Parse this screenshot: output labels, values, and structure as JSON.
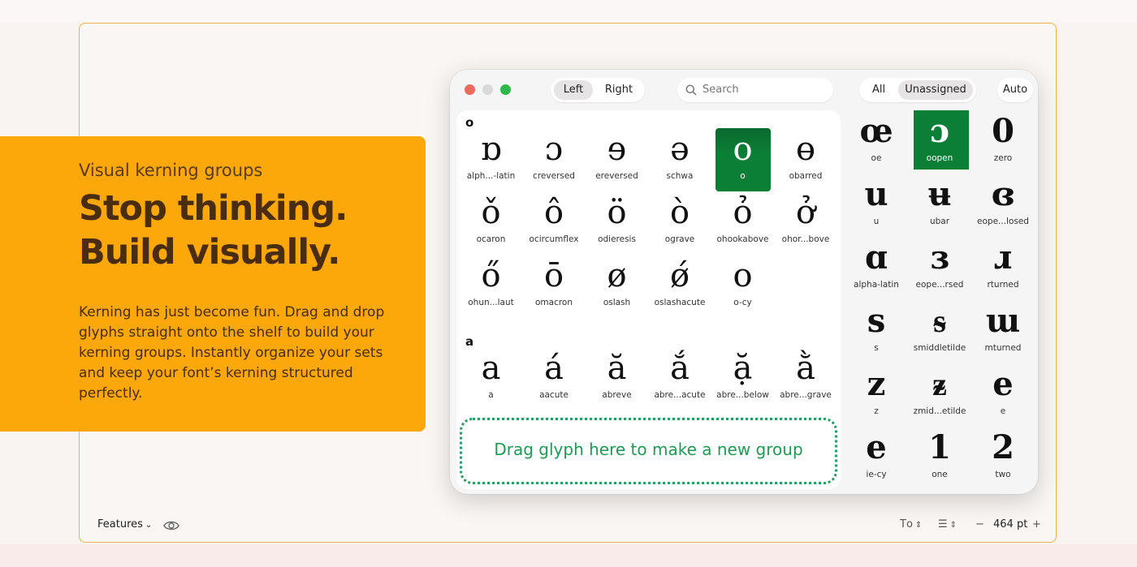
{
  "promo": {
    "kicker": "Visual kerning groups",
    "title_line1": "Stop thinking.",
    "title_line2": "Build visually.",
    "body": "Kerning has just become fun. Drag and drop glyphs straight onto the shelf to build your kerning groups. Instantly organize your sets and keep your font’s kerning structured perfectly."
  },
  "toolbar": {
    "side_left": "Left",
    "side_right": "Right",
    "search_placeholder": "Search",
    "filter_all": "All",
    "filter_unassigned": "Unassigned",
    "auto": "Auto"
  },
  "groups": [
    {
      "name": "o",
      "glyphs": [
        {
          "char": "ɒ",
          "label": "alph...-latin",
          "selected": false
        },
        {
          "char": "ɔ",
          "label": "creversed",
          "selected": false
        },
        {
          "char": "ɘ",
          "label": "ereversed",
          "selected": false
        },
        {
          "char": "ə",
          "label": "schwa",
          "selected": false
        },
        {
          "char": "o",
          "label": "o",
          "selected": true
        },
        {
          "char": "ɵ",
          "label": "obarred",
          "selected": false
        },
        {
          "char": "ǒ",
          "label": "ocaron",
          "selected": false
        },
        {
          "char": "ô",
          "label": "ocircumflex",
          "selected": false
        },
        {
          "char": "ö",
          "label": "odieresis",
          "selected": false
        },
        {
          "char": "ò",
          "label": "ograve",
          "selected": false
        },
        {
          "char": "ỏ",
          "label": "ohookabove",
          "selected": false
        },
        {
          "char": "ở",
          "label": "ohor...bove",
          "selected": false
        },
        {
          "char": "ő",
          "label": "ohun...laut",
          "selected": false
        },
        {
          "char": "ō",
          "label": "omacron",
          "selected": false
        },
        {
          "char": "ø",
          "label": "oslash",
          "selected": false
        },
        {
          "char": "ǿ",
          "label": "oslashacute",
          "selected": false
        },
        {
          "char": "о",
          "label": "o-cy",
          "selected": false
        }
      ]
    },
    {
      "name": "a",
      "glyphs": [
        {
          "char": "a",
          "label": "a",
          "selected": false
        },
        {
          "char": "á",
          "label": "aacute",
          "selected": false
        },
        {
          "char": "ă",
          "label": "abreve",
          "selected": false
        },
        {
          "char": "ắ",
          "label": "abre...acute",
          "selected": false
        },
        {
          "char": "ặ",
          "label": "abre...below",
          "selected": false
        },
        {
          "char": "ằ",
          "label": "abre...grave",
          "selected": false
        }
      ]
    }
  ],
  "dropzone_text": "Drag glyph here to make a new group",
  "unassigned": [
    {
      "char": "œ",
      "label": "oe",
      "selected": false
    },
    {
      "char": "ɔ",
      "label": "oopen",
      "selected": true
    },
    {
      "char": "0",
      "label": "zero",
      "selected": false
    },
    {
      "char": "u",
      "label": "u",
      "selected": false
    },
    {
      "char": "ʉ",
      "label": "ubar",
      "selected": false
    },
    {
      "char": "ɞ",
      "label": "eope...losed",
      "selected": false
    },
    {
      "char": "ɑ",
      "label": "alpha-latin",
      "selected": false
    },
    {
      "char": "ɜ",
      "label": "eope...rsed",
      "selected": false
    },
    {
      "char": "ɹ",
      "label": "rturned",
      "selected": false
    },
    {
      "char": "s",
      "label": "s",
      "selected": false
    },
    {
      "char": "ᵴ",
      "label": "smiddletilde",
      "selected": false
    },
    {
      "char": "ɯ",
      "label": "mturned",
      "selected": false
    },
    {
      "char": "z",
      "label": "z",
      "selected": false
    },
    {
      "char": "ᵶ",
      "label": "zmid...etilde",
      "selected": false
    },
    {
      "char": "e",
      "label": "e",
      "selected": false
    },
    {
      "char": "е",
      "label": "ie-cy",
      "selected": false
    },
    {
      "char": "1",
      "label": "one",
      "selected": false
    },
    {
      "char": "2",
      "label": "two",
      "selected": false
    }
  ],
  "bottom_bar": {
    "features_label": "Features",
    "size_value": "464 pt"
  },
  "colors": {
    "accent_orange": "#fca80b",
    "selection_green": "#0b7f36",
    "dropzone_green": "#1f9a55"
  }
}
